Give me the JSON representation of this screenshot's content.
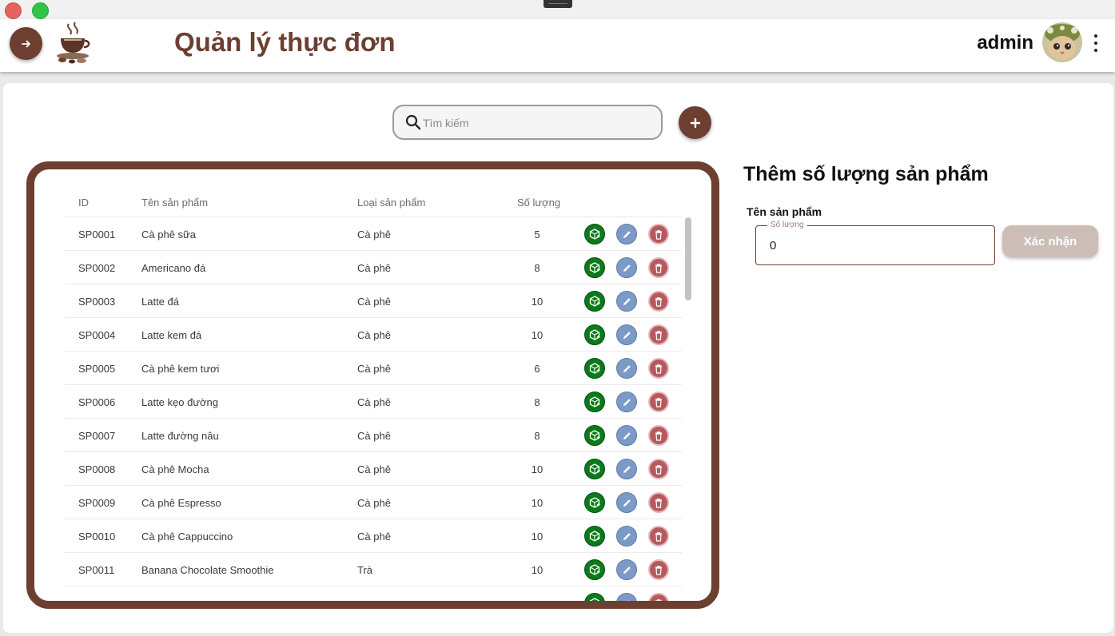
{
  "header": {
    "title": "Quản lý thực đơn",
    "username": "admin"
  },
  "search": {
    "placeholder": "Tìm kiếm",
    "value": ""
  },
  "table": {
    "columns": [
      "ID",
      "Tên sản phẩm",
      "Loại sản phẩm",
      "Số lượng"
    ],
    "rows": [
      {
        "id": "SP0001",
        "name": "Cà phê sữa",
        "type": "Cà phê",
        "qty": "5"
      },
      {
        "id": "SP0002",
        "name": "Americano đá",
        "type": "Cà phê",
        "qty": "8"
      },
      {
        "id": "SP0003",
        "name": "Latte đá",
        "type": "Cà phê",
        "qty": "10"
      },
      {
        "id": "SP0004",
        "name": "Latte kem đá",
        "type": "Cà phê",
        "qty": "10"
      },
      {
        "id": "SP0005",
        "name": "Cà phê kem tươi",
        "type": "Cà phê",
        "qty": "6"
      },
      {
        "id": "SP0006",
        "name": "Latte kẹo đường",
        "type": "Cà phê",
        "qty": "8"
      },
      {
        "id": "SP0007",
        "name": "Latte đường nâu",
        "type": "Cà phê",
        "qty": "8"
      },
      {
        "id": "SP0008",
        "name": "Cà phê Mocha",
        "type": "Cà phê",
        "qty": "10"
      },
      {
        "id": "SP0009",
        "name": "Cà phê Espresso",
        "type": "Cà phê",
        "qty": "10"
      },
      {
        "id": "SP0010",
        "name": "Cà phê Cappuccino",
        "type": "Cà phê",
        "qty": "10"
      },
      {
        "id": "SP0011",
        "name": "Banana Chocolate Smoothie",
        "type": "Trà",
        "qty": "10"
      },
      {
        "id": "",
        "name": "",
        "type": "",
        "qty": ""
      }
    ]
  },
  "panel": {
    "title": "Thêm số lượng sản phẩm",
    "product_label": "Tên sản phẩm",
    "quantity_label": "Số lượng",
    "quantity_value": "0",
    "confirm_label": "Xác nhận"
  },
  "icons": {
    "back": "arrow-right-icon",
    "logo": "coffee-cup-logo",
    "more": "kebab-menu-icon",
    "search": "search-icon",
    "add": "plus-icon",
    "row_add": "box-add-icon",
    "row_edit": "pencil-icon",
    "row_delete": "trash-icon"
  },
  "colors": {
    "brand": "#6d3f30",
    "add_action": "#0b7a1b",
    "edit_action": "#7c9ac8",
    "delete_action": "#b65a5f",
    "confirm_disabled": "#cdbdb7"
  }
}
